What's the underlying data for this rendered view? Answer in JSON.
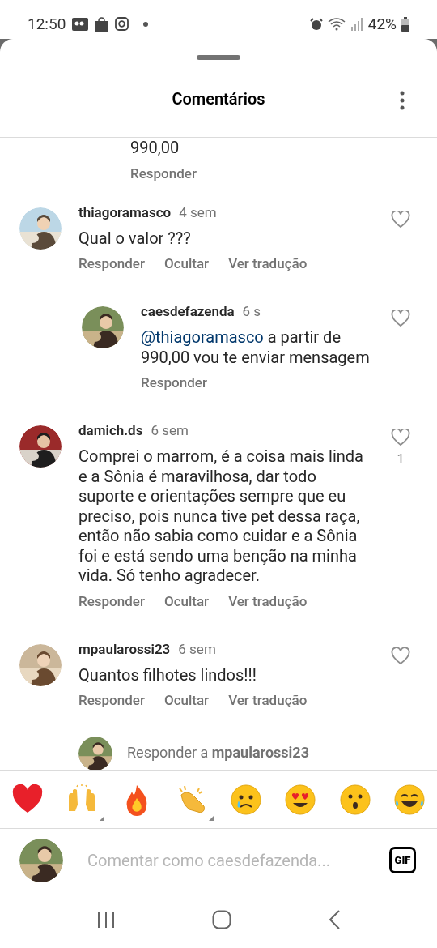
{
  "status_bar": {
    "time": "12:50",
    "battery": "42%"
  },
  "sheet": {
    "title": "Comentários"
  },
  "clipped_reply": {
    "text": "990,00",
    "actions": [
      "Responder"
    ]
  },
  "comments": [
    {
      "user": "thiagoramasco",
      "time": "4 sem",
      "text": "Qual o valor ???",
      "actions": [
        "Responder",
        "Ocultar",
        "Ver tradução"
      ],
      "liked": false,
      "replies": [
        {
          "user": "caesdefazenda",
          "time": "6 s",
          "mention": "@thiagoramasco",
          "text": "a partir de 990,00 vou te enviar mensagem",
          "actions": [
            "Responder"
          ],
          "liked": false
        }
      ]
    },
    {
      "user": "damich.ds",
      "time": "6 sem",
      "text": "Comprei o marrom, é a coisa mais linda e a Sônia é maravilhosa, dar todo suporte e orientações sempre que eu preciso, pois nunca tive pet dessa raça, então não sabia como cuidar e a Sônia foi e está sendo uma benção na minha vida. Só tenho agradecer.",
      "actions": [
        "Responder",
        "Ocultar",
        "Ver tradução"
      ],
      "liked": false,
      "likes": "1"
    },
    {
      "user": "mpaularossi23",
      "time": "6 sem",
      "text": "Quantos filhotes lindos!!!",
      "actions": [
        "Responder",
        "Ocultar",
        "Ver tradução"
      ],
      "liked": false
    }
  ],
  "reply_prompt": "Responder a **mpaularossi23**",
  "emoji_bar": [
    {
      "kind": "heart",
      "variants": false
    },
    {
      "kind": "raised-hands",
      "variants": true
    },
    {
      "kind": "fire",
      "variants": false
    },
    {
      "kind": "clap",
      "variants": true
    },
    {
      "kind": "crying",
      "variants": false
    },
    {
      "kind": "heart-eyes",
      "variants": false
    },
    {
      "kind": "surprised",
      "variants": false
    },
    {
      "kind": "laughing",
      "variants": false
    }
  ],
  "composer": {
    "placeholder": "Comentar como caesdefazenda...",
    "gif": "GIF"
  }
}
